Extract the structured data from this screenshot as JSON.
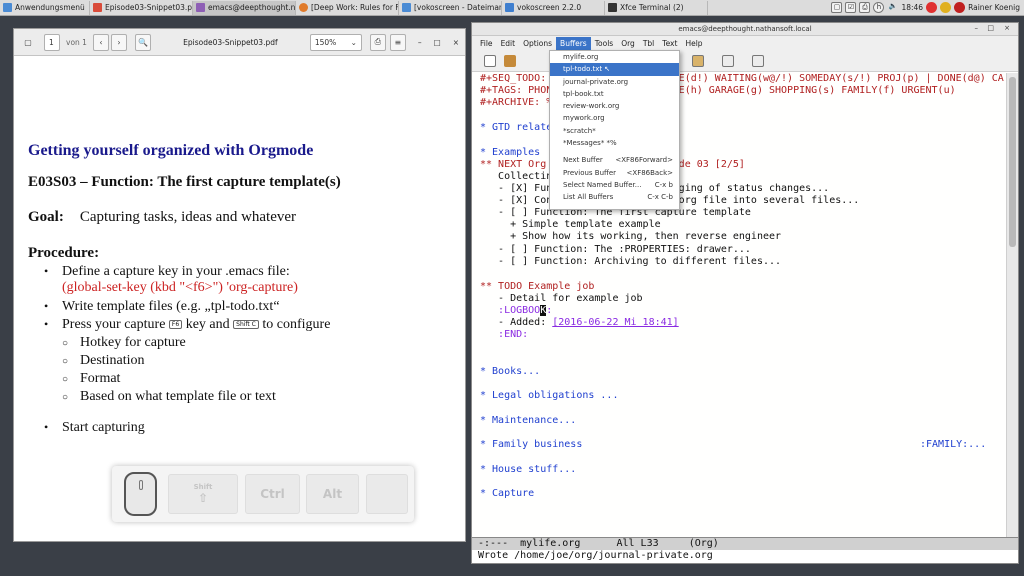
{
  "taskbar": {
    "menu_label": "Anwendungsmenü",
    "tasks": [
      {
        "label": "Episode03-Snippet03.pdf",
        "color": "#d94b3a"
      },
      {
        "label": "emacs@deepthought.na...",
        "color": "#8e5fb5"
      },
      {
        "label": "[Deep Work: Rules for F...",
        "color": "#e07a2a"
      },
      {
        "label": "[vokoscreen - Dateiman...",
        "color": "#4a8bd4"
      },
      {
        "label": "vokoscreen 2.2.0",
        "color": "#3f7fcf"
      },
      {
        "label": "Xfce Terminal (2)",
        "color": "#333333"
      }
    ],
    "clock": "18:46",
    "user": "Rainer Koenig"
  },
  "pdf": {
    "page_value": "1",
    "page_of": "von 1",
    "filename": "Episode03-Snippet03.pdf",
    "zoom": "150%",
    "slide": {
      "title": "Getting yourself organized with Orgmode",
      "subtitle": "E03S03 –  Function: The first capture template(s)",
      "goal_label": "Goal:",
      "goal_text": "Capturing tasks, ideas and whatever",
      "procedure_label": "Procedure:",
      "bullet1": "Define a capture key in your .emacs file:",
      "bullet1_code": "(global-set-key (kbd \"<f6>\") 'org-capture)",
      "bullet2": "Write template files (e.g. „tpl-todo.txt“",
      "bullet3_a": "Press your capture",
      "bullet3_key1": "F6",
      "bullet3_b": "key and",
      "bullet3_key2": "Shift C",
      "bullet3_c": "to configure",
      "sub_items": [
        "Hotkey for capture",
        "Destination",
        "Format",
        "Based on what template file or text"
      ],
      "bullet4": "Start capturing",
      "keys": {
        "shift": "Shift",
        "ctrl": "Ctrl",
        "alt": "Alt"
      }
    }
  },
  "emacs": {
    "title": "emacs@deepthought.nathansoft.local",
    "menus": [
      "File",
      "Edit",
      "Options",
      "Buffers",
      "Tools",
      "Org",
      "Tbl",
      "Text",
      "Help"
    ],
    "buffer_lines": {
      "l1": "#+SEQ_TODO: NEXT(n) TODO(t) | DONE(d!) WAITING(w@/!) SOMEDAY(s/!) PROJ(p) | DONE(d@) CA",
      "l2": "#+TAGS: PHONE(o) COMPUTER(c) @HOME(h) GARAGE(g) SHOPPING(s) FAMILY(f) URGENT(u)",
      "l3": "#+ARCHIVE: %s_done::",
      "l4": "* GTD related stuff...",
      "l5": "* Examples",
      "l6": "** NEXT Org Mode Tutorials: Episode 03 [2/5]",
      "l7": "   Collecting ideas and tasks",
      "l8": "   - [X] Function: Setting up logging of status changes...",
      "l9": "   - [X] Concept: Splitting your org file into several files...",
      "l10": "   - [ ] Function: The first capture template",
      "l11": "     + Simple template example",
      "l12": "     + Show how its working, then reverse engineer",
      "l13": "   - [ ] Function: The :PROPERTIES: drawer...",
      "l14": "   - [ ] Function: Archiving to different files...",
      "l15": "** TODO Example job",
      "l16": "   - Detail for example job",
      "l17a": "   :LOGBOO",
      "l17b": "K",
      "l17c": ":",
      "l18a": "   - Added: ",
      "l18b": "[2016-06-22 Mi 18:41]",
      "l19": "   :END:",
      "l20": "* Books...",
      "l21": "* Legal obligations ...",
      "l22": "* Maintenance...",
      "l23a": "* Family business",
      "l23b": ":FAMILY:...",
      "l24": "* House stuff...",
      "l25": "* Capture"
    },
    "mode_line": "-:---  mylife.org      All L33     (Org)",
    "echo": "Wrote /home/joe/org/journal-private.org",
    "buffers_menu": {
      "items": [
        "mylife.org",
        "tpl-todo.txt",
        "journal-private.org",
        "tpl-book.txt",
        "review-work.org",
        "mywork.org",
        "*scratch*",
        "*Messages*  *%"
      ],
      "selected": "tpl-todo.txt",
      "actions": [
        {
          "label": "Next Buffer",
          "accel": "<XF86Forward>"
        },
        {
          "label": "Previous Buffer",
          "accel": "<XF86Back>"
        },
        {
          "label": "Select Named Buffer...",
          "accel": "C-x b"
        },
        {
          "label": "List All Buffers",
          "accel": "C-x C-b"
        }
      ]
    }
  },
  "colors": {
    "slide_title": "#1a1a8c",
    "code_red": "#cc2222",
    "org_keyword": "#b02020",
    "org_heading": "#1f3fcf",
    "menu_highlight": "#3b74c8"
  }
}
